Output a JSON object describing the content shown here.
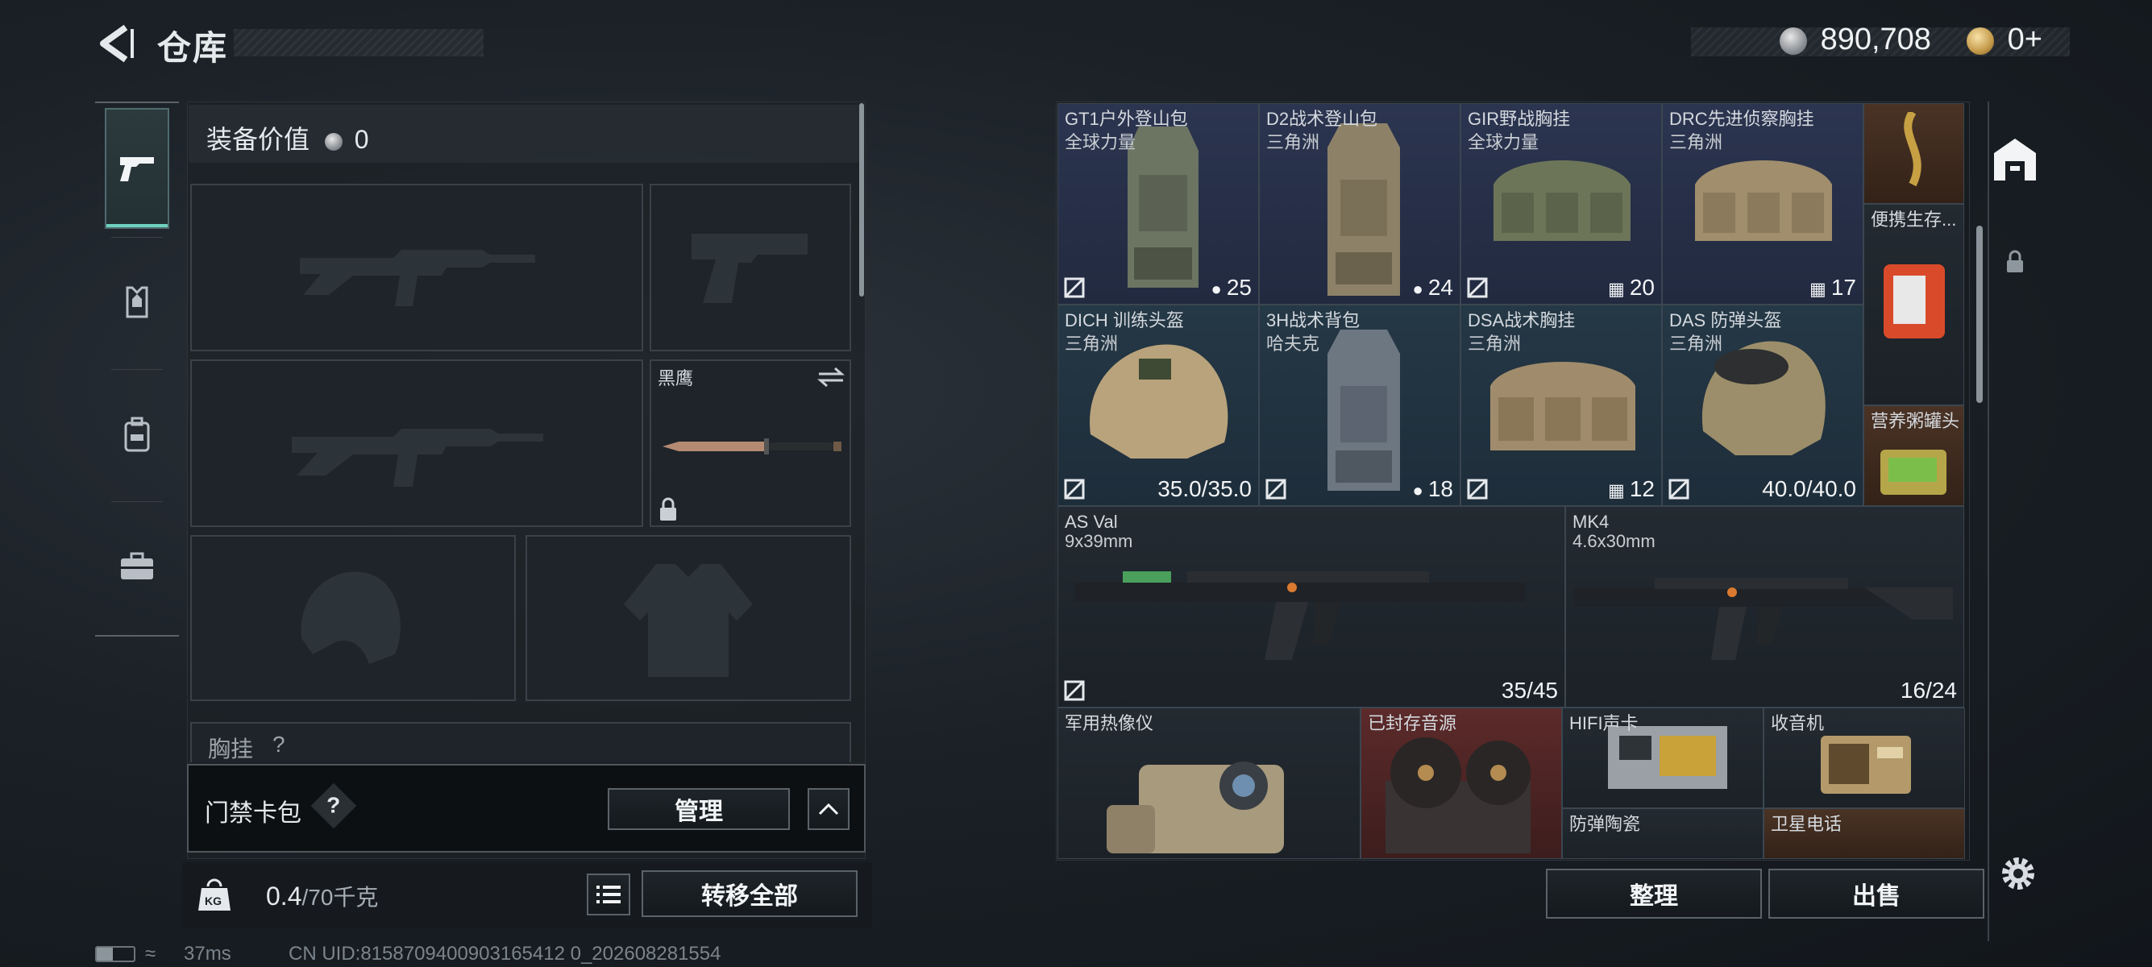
{
  "header": {
    "title": "仓库"
  },
  "currency": {
    "silver": "890,708",
    "gold": "0+"
  },
  "loadout": {
    "gear_value_label": "装备价值",
    "gear_value": "0",
    "melee_name": "黑鹰",
    "chest_label": "胸挂",
    "chest_count": "?",
    "keycard_label": "门禁卡包",
    "keycard_help": "?",
    "manage_label": "管理",
    "weight": "0.4",
    "weight_max": "/70千克",
    "weight_icon_text": "KG",
    "transfer_all_label": "转移全部"
  },
  "stash": {
    "items": [
      {
        "name": "GT1户外登山包",
        "sub": "全球力量",
        "value": "25",
        "icon": "capacity-icon"
      },
      {
        "name": "D2战术登山包",
        "sub": "三角洲",
        "value": "24",
        "icon": "capacity-icon"
      },
      {
        "name": "GIR野战胸挂",
        "sub": "全球力量",
        "value": "20",
        "icon": "vest-icon"
      },
      {
        "name": "DRC先进侦察胸挂",
        "sub": "三角洲",
        "value": "17",
        "icon": "vest-icon"
      },
      {
        "name": "DICH 训练头盔",
        "sub": "三角洲",
        "value": "35.0/35.0",
        "icon": ""
      },
      {
        "name": "3H战术背包",
        "sub": "哈夫克",
        "value": "18",
        "icon": "capacity-icon"
      },
      {
        "name": "DSA战术胸挂",
        "sub": "三角洲",
        "value": "12",
        "icon": "vest-icon"
      },
      {
        "name": "DAS 防弹头盔",
        "sub": "三角洲",
        "value": "40.0/40.0",
        "icon": ""
      },
      {
        "name": "AS Val",
        "sub": "9x39mm",
        "value": "35/45",
        "icon": ""
      },
      {
        "name": "MK4",
        "sub": "4.6x30mm",
        "value": "16/24",
        "icon": ""
      },
      {
        "name": "军用热像仪",
        "sub": "",
        "value": "",
        "icon": ""
      },
      {
        "name": "已封存音源",
        "sub": "",
        "value": "",
        "icon": ""
      },
      {
        "name": "HIFI声卡",
        "sub": "",
        "value": "",
        "icon": ""
      },
      {
        "name": "收音机",
        "sub": "",
        "value": "",
        "icon": ""
      },
      {
        "name": "防弹陶瓷",
        "sub": "",
        "value": "",
        "icon": ""
      },
      {
        "name": "卫星电话",
        "sub": "",
        "value": "",
        "icon": ""
      },
      {
        "name": "便携生存...",
        "sub": "",
        "value": "",
        "icon": ""
      },
      {
        "name": "营养粥罐头",
        "sub": "",
        "value": "",
        "icon": ""
      }
    ],
    "sort_label": "整理",
    "sell_label": "出售"
  },
  "status": {
    "ping": "37ms",
    "uid": "CN UID:8158709400903165412 0_202608281554"
  },
  "colors": {
    "accent": "#6fd1c0",
    "navy_cell": "#2c3550",
    "red_cell": "#5c2a2a"
  }
}
